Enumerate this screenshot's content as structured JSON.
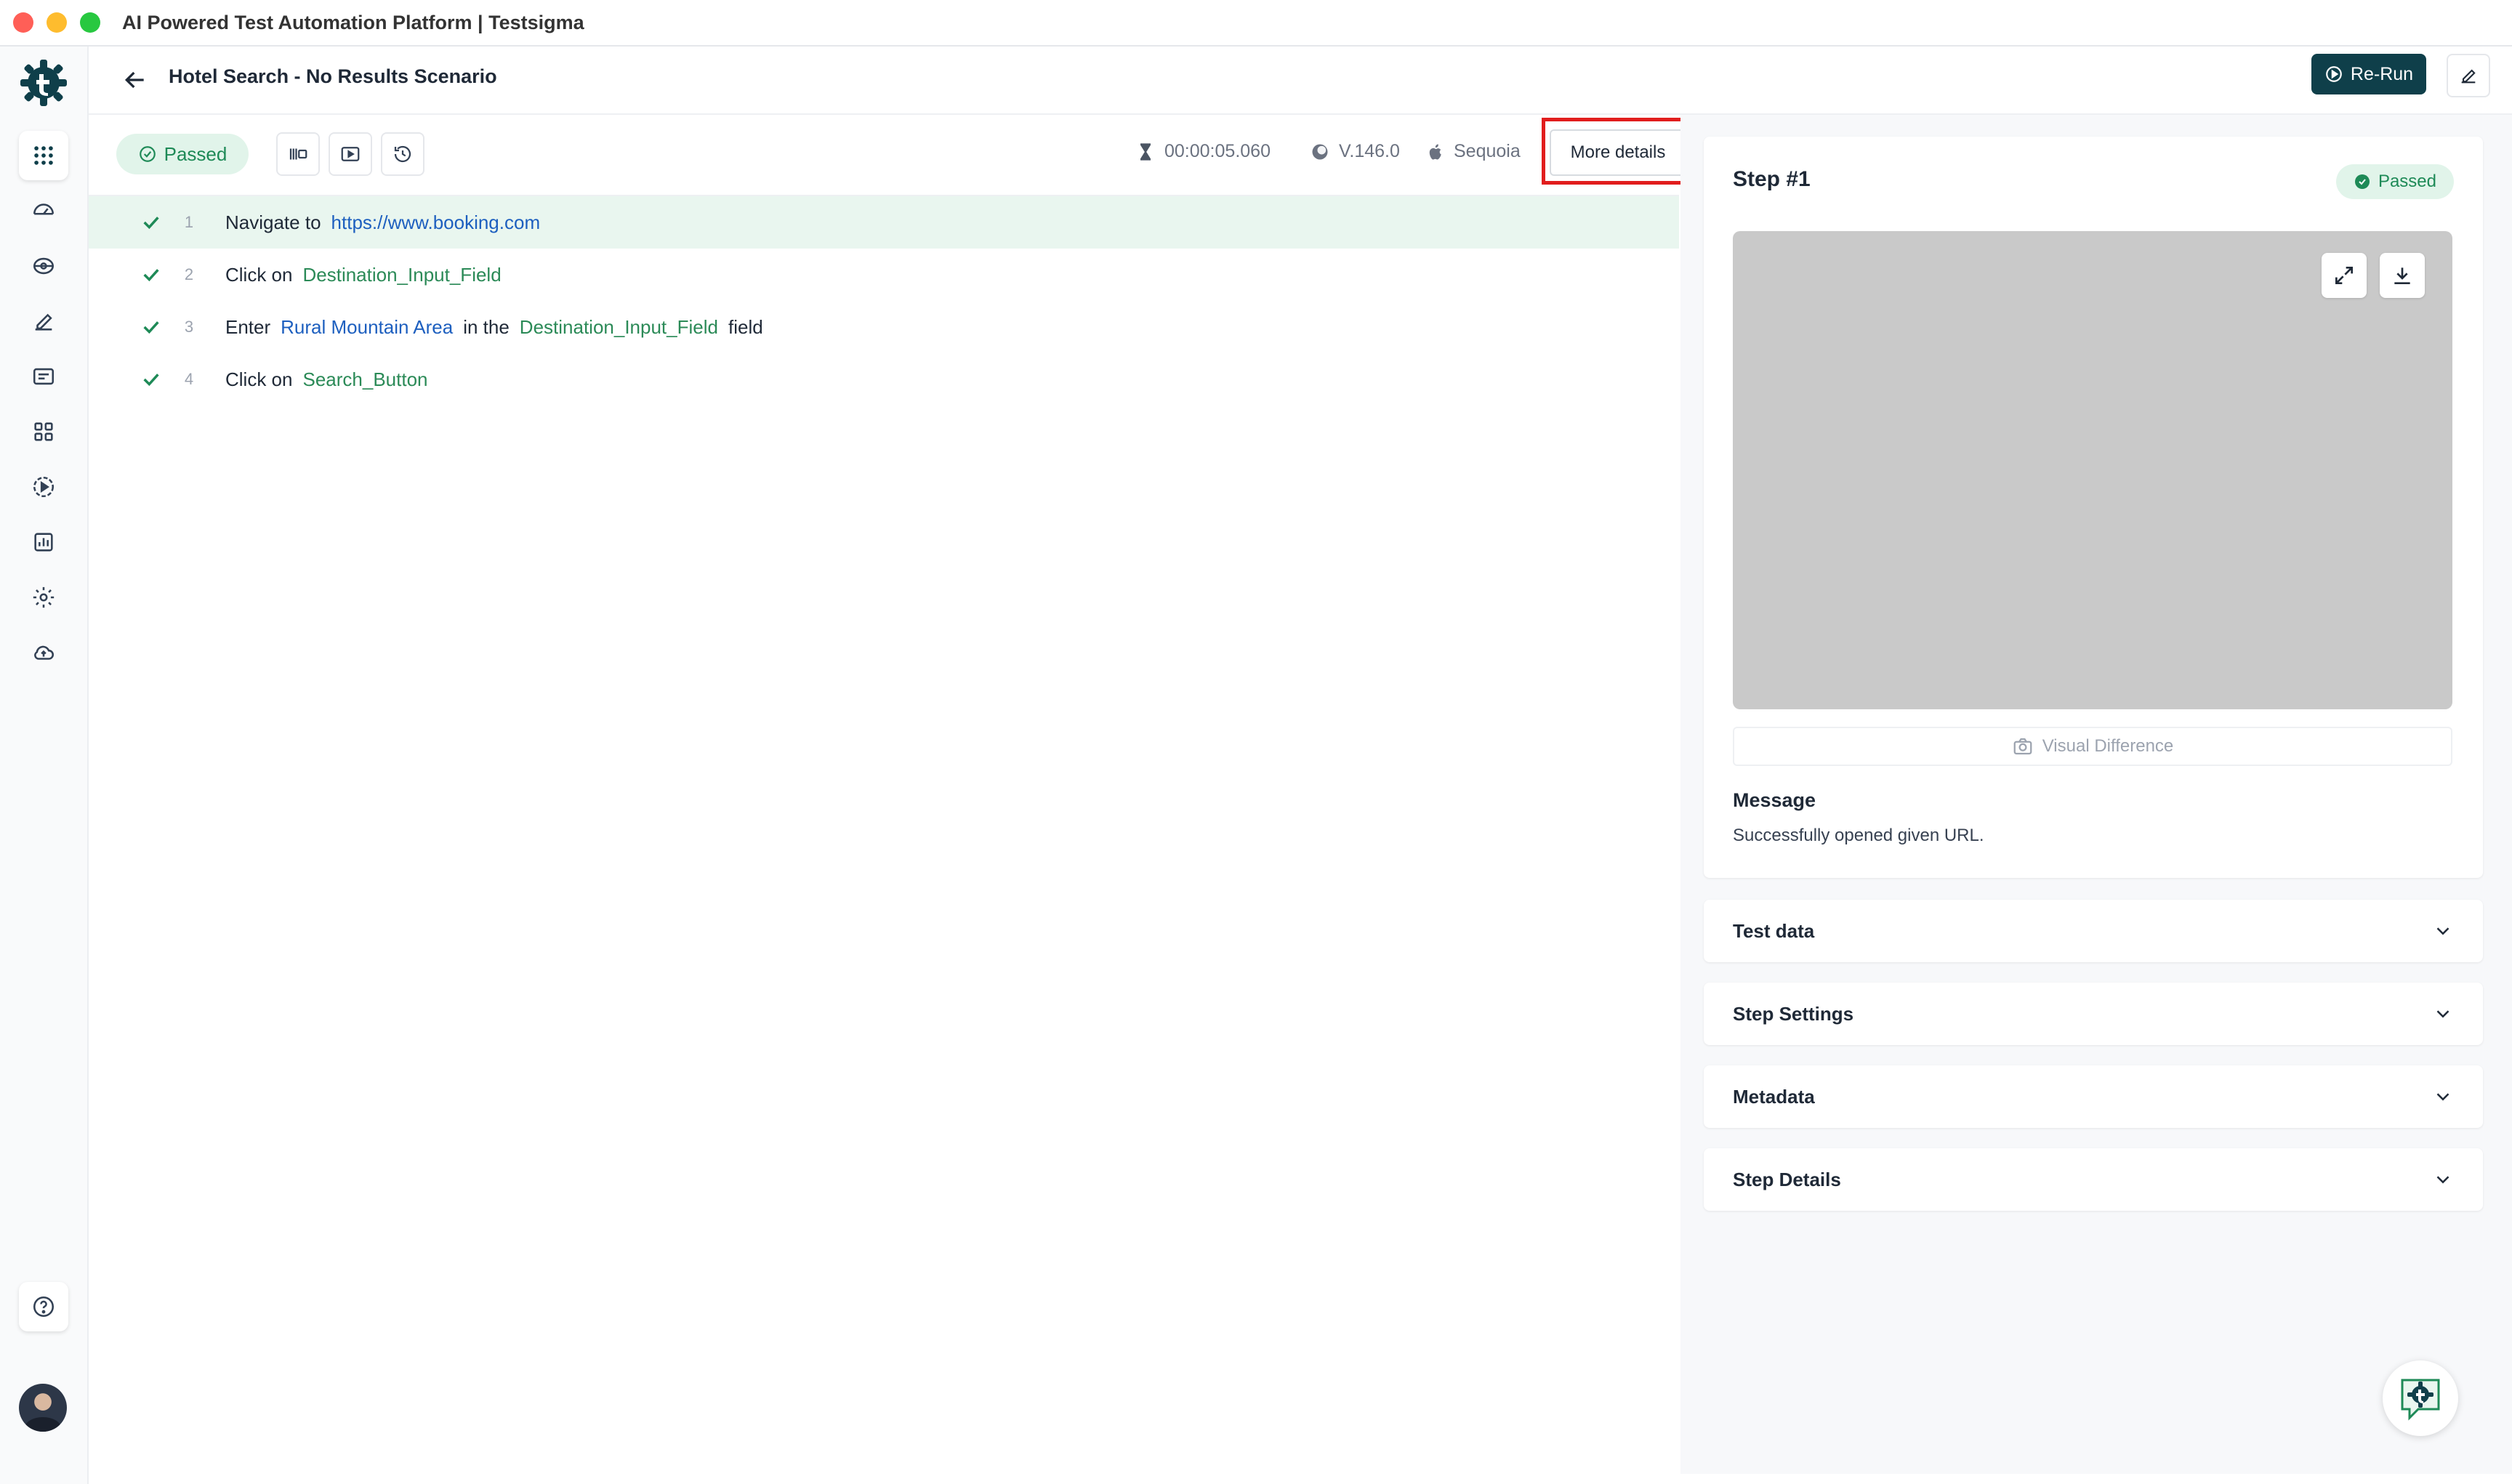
{
  "window": {
    "title": "AI Powered Test Automation Platform | Testsigma"
  },
  "sidebar": {
    "items": [
      {
        "icon": "apps-grid-icon"
      },
      {
        "icon": "dashboard-icon"
      },
      {
        "icon": "test-plan-icon"
      },
      {
        "icon": "edit-icon"
      },
      {
        "icon": "folder-icon"
      },
      {
        "icon": "modules-icon"
      },
      {
        "icon": "run-icon"
      },
      {
        "icon": "reports-icon"
      },
      {
        "icon": "settings-icon"
      },
      {
        "icon": "cloud-upload-icon"
      }
    ],
    "help_icon": "help-icon"
  },
  "header": {
    "title": "Hotel Search - No Results Scenario",
    "rerun_label": "Re-Run"
  },
  "toolbar": {
    "status": "Passed",
    "duration": "00:00:05.060",
    "version": "V.146.0",
    "os": "Sequoia",
    "more_details_label": "More details"
  },
  "steps": [
    {
      "num": "1",
      "parts": [
        {
          "t": "text",
          "v": "Navigate to"
        },
        {
          "t": "url",
          "v": "https://www.booking.com"
        }
      ]
    },
    {
      "num": "2",
      "parts": [
        {
          "t": "text",
          "v": "Click on"
        },
        {
          "t": "elem",
          "v": "Destination_Input_Field"
        }
      ]
    },
    {
      "num": "3",
      "parts": [
        {
          "t": "text",
          "v": "Enter"
        },
        {
          "t": "data",
          "v": "Rural Mountain Area"
        },
        {
          "t": "text",
          "v": "in the"
        },
        {
          "t": "elem",
          "v": "Destination_Input_Field"
        },
        {
          "t": "text",
          "v": "field"
        }
      ]
    },
    {
      "num": "4",
      "parts": [
        {
          "t": "text",
          "v": "Click on"
        },
        {
          "t": "elem",
          "v": "Search_Button"
        }
      ]
    }
  ],
  "step_detail": {
    "title": "Step #1",
    "status": "Passed",
    "visual_difference_label": "Visual Difference",
    "message_label": "Message",
    "message_text": "Successfully opened given URL."
  },
  "accordions": [
    "Test data",
    "Step Settings",
    "Metadata",
    "Step Details"
  ],
  "colors": {
    "brand": "#0f3f4a",
    "success": "#1e8a57",
    "highlight": "#e11d1d"
  }
}
